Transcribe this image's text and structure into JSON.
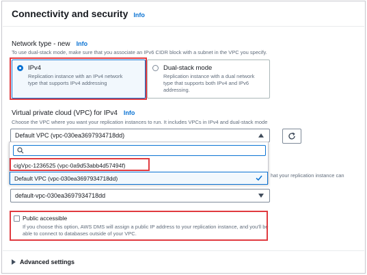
{
  "section": {
    "title": "Connectivity and security",
    "info": "Info"
  },
  "network_type": {
    "label": "Network type - new",
    "info": "Info",
    "description": "To use dual-stack mode, make sure that you associate an IPv6 CIDR block with a subnet in the VPC you specify.",
    "options": [
      {
        "title": "IPv4",
        "description": "Replication instance with an IPv4 network type that supports IPv4 addressing",
        "selected": true
      },
      {
        "title": "Dual-stack mode",
        "description": "Replication instance with a dual network type that supports both IPv4 and IPv6 addressing.",
        "selected": false
      }
    ]
  },
  "vpc": {
    "label": "Virtual private cloud (VPC) for IPv4",
    "info": "Info",
    "description": "Choose the VPC where you want your replication instances to run. It includes VPCs in IPv4 and dual-stack mode",
    "selected_value": "Default VPC (vpc-030ea3697934718dd)",
    "search_placeholder": "",
    "options": [
      {
        "label": "cigVpc-1236525 (vpc-0a9d53abb4d57494f)",
        "selected": false
      },
      {
        "label": "Default VPC (vpc-030ea3697934718dd)",
        "selected": true
      }
    ]
  },
  "hidden_description_tail": "hat your replication instance can",
  "subnet_group": {
    "selected_value": "default-vpc-030ea3697934718dd"
  },
  "public_access": {
    "label": "Public accessible",
    "description": "If you choose this option, AWS DMS will assign a public IP address to your replication instance, and you'll be able to connect to databases outside of your VPC.",
    "checked": false
  },
  "advanced": {
    "label": "Advanced settings"
  },
  "colors": {
    "accent": "#0972d3",
    "highlight": "#e0393e",
    "muted": "#5f6b7a"
  }
}
